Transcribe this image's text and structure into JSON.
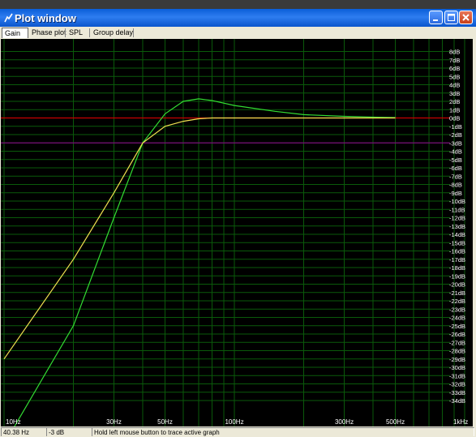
{
  "window": {
    "title": "Plot window"
  },
  "tabs": [
    {
      "label": "Gain",
      "active": true
    },
    {
      "label": "Phase plot",
      "active": false
    },
    {
      "label": "SPL",
      "active": false
    },
    {
      "label": "Group delay",
      "active": false
    }
  ],
  "status": {
    "frequency": "40.38 Hz",
    "level": "-3 dB",
    "hint": "Hold left mouse button to trace active graph"
  },
  "colors": {
    "background": "#000000",
    "grid": "#0a5a0a",
    "reference_0db": "#c80000",
    "reference_minus3db": "#7a0a7a",
    "trace_green": "#33dd33",
    "trace_yellow": "#f0e050",
    "labels": "#ffffff"
  },
  "chart_data": {
    "type": "line",
    "x_scale": "log",
    "xlim": [
      10,
      1000
    ],
    "ylim": [
      -35,
      9
    ],
    "x_tick_labels": [
      {
        "x": 10,
        "label": "10Hz"
      },
      {
        "x": 30,
        "label": "30Hz"
      },
      {
        "x": 50,
        "label": "50Hz"
      },
      {
        "x": 100,
        "label": "100Hz"
      },
      {
        "x": 300,
        "label": "300Hz"
      },
      {
        "x": 500,
        "label": "500Hz"
      },
      {
        "x": 1000,
        "label": "1kHz"
      }
    ],
    "y_tick_labels": [
      "8dB",
      "7dB",
      "6dB",
      "5dB",
      "4dB",
      "3dB",
      "2dB",
      "1dB",
      "0dB",
      "-1dB",
      "-2dB",
      "-3dB",
      "-4dB",
      "-5dB",
      "-6dB",
      "-7dB",
      "-8dB",
      "-9dB",
      "-10dB",
      "-11dB",
      "-12dB",
      "-13dB",
      "-14dB",
      "-15dB",
      "-16dB",
      "-17dB",
      "-18dB",
      "-19dB",
      "-20dB",
      "-21dB",
      "-22dB",
      "-23dB",
      "-24dB",
      "-25dB",
      "-26dB",
      "-27dB",
      "-28dB",
      "-29dB",
      "-30dB",
      "-31dB",
      "-32dB",
      "-33dB",
      "-34dB"
    ],
    "reference_lines": [
      {
        "y": 0,
        "color": "#c80000"
      },
      {
        "y": -3,
        "color": "#7a0a7a"
      }
    ],
    "series": [
      {
        "color": "#33dd33",
        "points": [
          [
            10,
            -43
          ],
          [
            20,
            -25
          ],
          [
            30,
            -12
          ],
          [
            40,
            -3
          ],
          [
            50,
            0.5
          ],
          [
            60,
            2
          ],
          [
            70,
            2.3
          ],
          [
            80,
            2.1
          ],
          [
            100,
            1.5
          ],
          [
            150,
            0.8
          ],
          [
            200,
            0.4
          ],
          [
            300,
            0.2
          ],
          [
            400,
            0.1
          ],
          [
            500,
            0.05
          ]
        ]
      },
      {
        "color": "#f0e050",
        "points": [
          [
            10,
            -29
          ],
          [
            20,
            -17
          ],
          [
            30,
            -9
          ],
          [
            40,
            -3
          ],
          [
            50,
            -1
          ],
          [
            60,
            -0.4
          ],
          [
            70,
            -0.1
          ],
          [
            80,
            0
          ],
          [
            100,
            0
          ],
          [
            200,
            0
          ],
          [
            300,
            0
          ],
          [
            400,
            0
          ],
          [
            500,
            0
          ]
        ]
      }
    ]
  }
}
